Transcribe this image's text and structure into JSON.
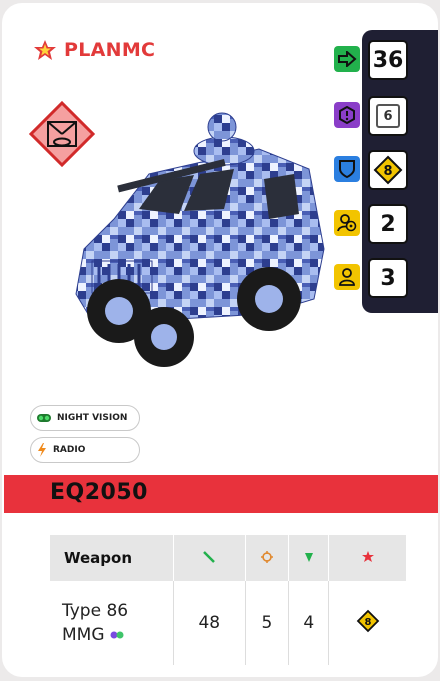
{
  "faction": {
    "name": "PLANMC",
    "star_color": "#e23a3a"
  },
  "stats": [
    {
      "icon": "move-arrow-icon",
      "color": "#22b14c",
      "value": "36"
    },
    {
      "icon": "armor-alert-icon",
      "color": "#8a3ec8",
      "value": "6"
    },
    {
      "icon": "defense-shield-icon",
      "color": "#2b7fe0",
      "value": "8"
    },
    {
      "icon": "crew-driver-icon",
      "color": "#f2c400",
      "value": "2"
    },
    {
      "icon": "crew-person-icon",
      "color": "#f2c400",
      "value": "3"
    }
  ],
  "traits": [
    {
      "icon": "goggles-icon",
      "label": "NIGHT VISION"
    },
    {
      "icon": "lightning-icon",
      "label": "RADIO"
    }
  ],
  "unit": {
    "name": "EQ2050",
    "banner_color": "#e8323c"
  },
  "weapons": {
    "header": "Weapon",
    "rows": [
      {
        "name_line1": "Type 86",
        "name_line2": "MMG",
        "range": "48",
        "accuracy": "5",
        "penetration": "4",
        "special_value": "8"
      }
    ]
  }
}
